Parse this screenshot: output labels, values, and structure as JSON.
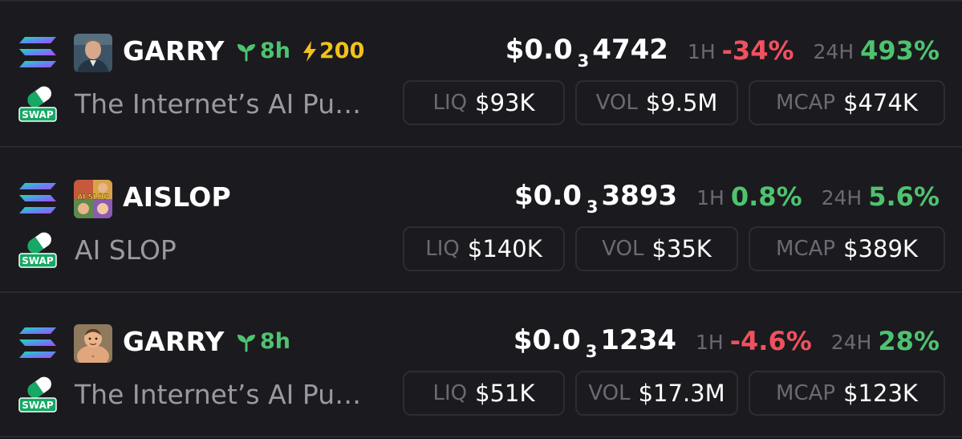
{
  "tokens": [
    {
      "symbol": "GARRY",
      "age": "8h",
      "boost": "200",
      "name": "The Internet’s AI Pu…",
      "price_prefix": "$0.0",
      "price_zero_count": "3",
      "price_digits": "4742",
      "tf_1h_label": "1H",
      "change_1h": "-34%",
      "change_1h_dir": "down",
      "tf_24h_label": "24H",
      "change_24h": "493%",
      "change_24h_dir": "up",
      "liq_label": "LIQ",
      "liq": "$93K",
      "vol_label": "VOL",
      "vol": "$9.5M",
      "mcap_label": "MCAP",
      "mcap": "$474K",
      "avatar_icon": "portrait-man-avatar"
    },
    {
      "symbol": "AISLOP",
      "age": "",
      "boost": "",
      "name": "AI SLOP",
      "price_prefix": "$0.0",
      "price_zero_count": "3",
      "price_digits": "3893",
      "tf_1h_label": "1H",
      "change_1h": "0.8%",
      "change_1h_dir": "up",
      "tf_24h_label": "24H",
      "change_24h": "5.6%",
      "change_24h_dir": "up",
      "liq_label": "LIQ",
      "liq": "$140K",
      "vol_label": "VOL",
      "vol": "$35K",
      "mcap_label": "MCAP",
      "mcap": "$389K",
      "avatar_icon": "ai-slop-collage-avatar",
      "avatar_text": "AI SLOP"
    },
    {
      "symbol": "GARRY",
      "age": "8h",
      "boost": "",
      "name": "The Internet’s AI Pu…",
      "price_prefix": "$0.0",
      "price_zero_count": "3",
      "price_digits": "1234",
      "tf_1h_label": "1H",
      "change_1h": "-4.6%",
      "change_1h_dir": "down",
      "tf_24h_label": "24H",
      "change_24h": "28%",
      "change_24h_dir": "up",
      "liq_label": "LIQ",
      "liq": "$51K",
      "vol_label": "VOL",
      "vol": "$17.3M",
      "mcap_label": "MCAP",
      "mcap": "$123K",
      "avatar_icon": "cartoon-chubby-man-avatar"
    }
  ],
  "swap_label": "SWAP",
  "colors": {
    "background": "#1b1a1f",
    "divider": "#2a2930",
    "up": "#4ec36f",
    "down": "#f0515e",
    "boost": "#f2c21a",
    "muted": "#6b6a73",
    "name": "#9a99a1"
  }
}
